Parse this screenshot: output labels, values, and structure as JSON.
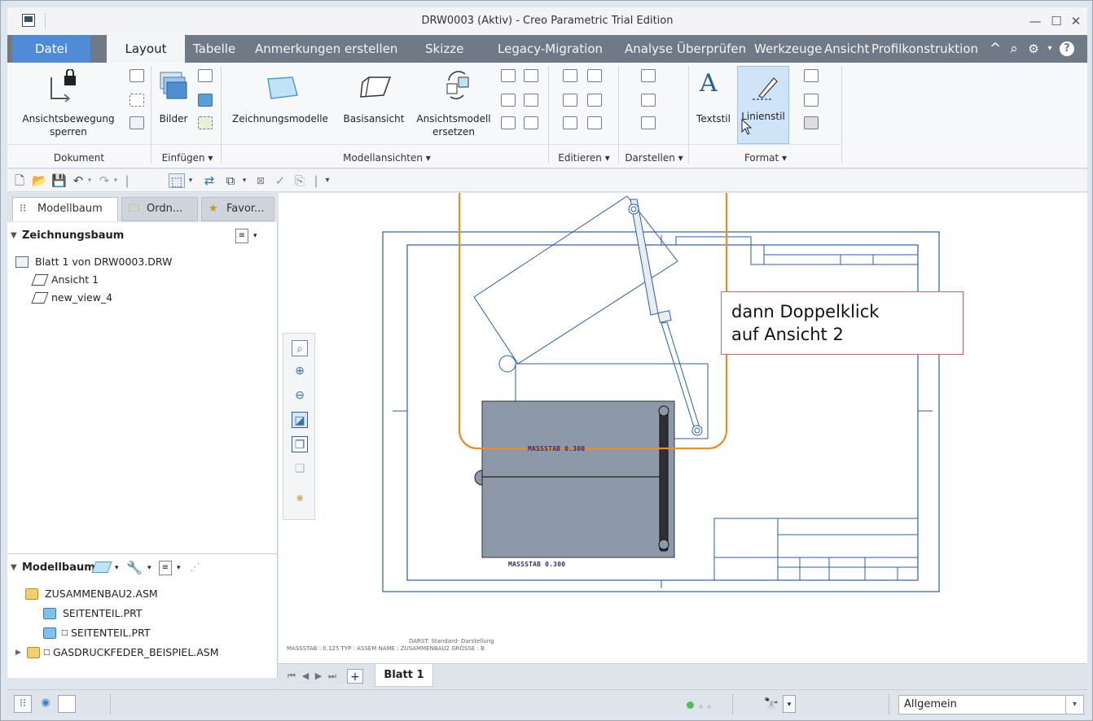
{
  "window": {
    "title": "DRW0003 (Aktiv) - Creo Parametric Trial Edition",
    "minimize_glyph": "—",
    "maximize_glyph": "☐",
    "close_glyph": "✕"
  },
  "tabs": {
    "file": "Datei",
    "layout": "Layout",
    "tabelle": "Tabelle",
    "anmerkungen": "Anmerkungen erstellen",
    "skizze": "Skizze",
    "legacy": "Legacy-Migration",
    "analyse": "Analyse",
    "ueberpruefen": "Überprüfen",
    "werkzeuge": "Werkzeuge",
    "ansicht": "Ansicht",
    "profil": "Profilkonstruktion",
    "collapse_glyph": "^",
    "search_glyph": "⌕",
    "help_glyph": "?"
  },
  "ribbon": {
    "lock_view_line1": "Ansichtsbewegung",
    "lock_view_line2": "sperren",
    "images": "Bilder",
    "drawing_models": "Zeichnungsmodelle",
    "base_view": "Basisansicht",
    "replace_view_line1": "Ansichtsmodell",
    "replace_view_line2": "ersetzen",
    "text_style": "Textstil",
    "line_style": "Linienstil",
    "groups": {
      "dokument": "Dokument",
      "einfuegen": "Einfügen ▾",
      "modellansichten": "Modellansichten ▾",
      "editieren": "Editieren ▾",
      "darstellen": "Darstellen ▾",
      "format": "Format ▾"
    }
  },
  "left_panel": {
    "tabs": {
      "modelltree": "Modellbaum",
      "folder": "Ordn...",
      "favorites": "Favor..."
    },
    "drawing_tree_header": "Zeichnungsbaum",
    "drawing_tree": [
      "Blatt 1 von DRW0003.DRW",
      "Ansicht 1",
      "new_view_4"
    ],
    "model_tree_header": "Modellbaum",
    "model_tree": [
      "ZUSAMMENBAU2.ASM",
      "SEITENTEIL.PRT",
      "SEITENTEIL.PRT",
      "GASDRUCKFEDER_BEISPIEL.ASM"
    ]
  },
  "canvas": {
    "scale_label_1": "MASSSTAB  0.300",
    "scale_label_2": "MASSSTAB  0.300",
    "footer_line1": "DARST: Standard- Darstellung",
    "footer_line2": "MASSSTAB : 0.125    TYP : ASSEM    NAME : ZUSAMMENBAU2    GRÖSSE : B",
    "callout_line1": "dann Doppelklick",
    "callout_line2": "auf Ansicht 2",
    "highlight_color": "#f08a24",
    "line_color": "#2b5ea8",
    "view_fill": "#8d98a8"
  },
  "sheetbar": {
    "sheet_name": "Blatt 1",
    "add_glyph": "+"
  },
  "statusbar": {
    "filter_value": "Allgemein"
  }
}
